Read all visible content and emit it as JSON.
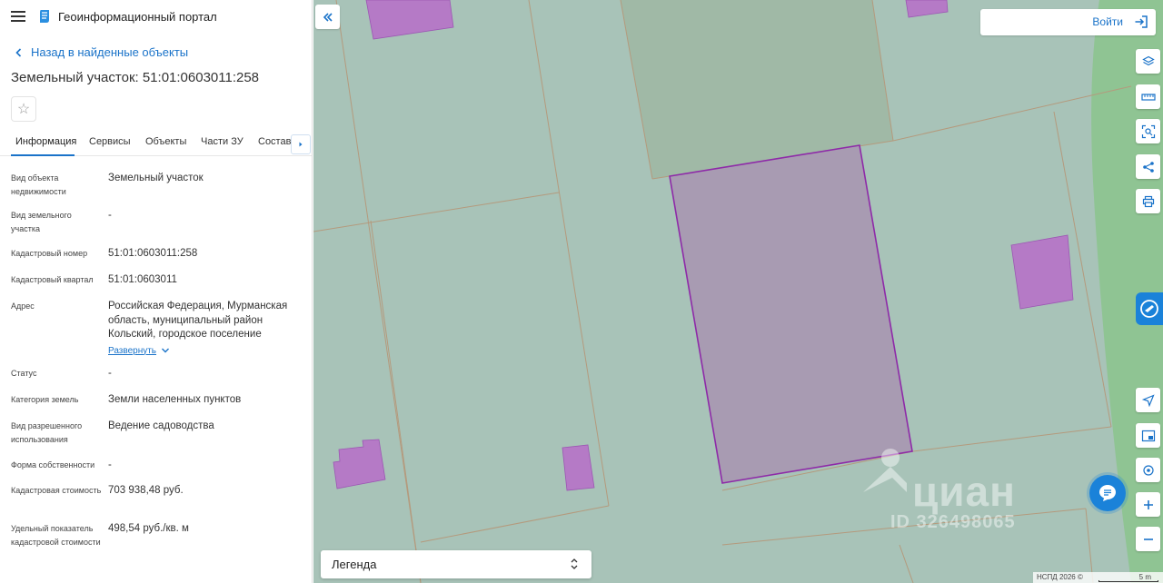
{
  "header": {
    "portal_title": "Геоинформационный портал"
  },
  "nav": {
    "back_label": "Назад в найденные объекты"
  },
  "object": {
    "title": "Земельный участок: 51:01:0603011:258"
  },
  "tabs": [
    {
      "label": "Информация",
      "active": true
    },
    {
      "label": "Сервисы"
    },
    {
      "label": "Объекты"
    },
    {
      "label": "Части ЗУ"
    },
    {
      "label": "Состав"
    }
  ],
  "properties": [
    {
      "label": "Вид объекта недвижимости",
      "value": "Земельный участок"
    },
    {
      "label": "Вид земельного участка",
      "value": "-"
    },
    {
      "label": "Кадастровый номер",
      "value": "51:01:0603011:258"
    },
    {
      "label": "Кадастровый квартал",
      "value": "51:01:0603011"
    },
    {
      "label": "Адрес",
      "value": "Российская Федерация, Мурманская область, муниципальный район Кольский, городское поселение",
      "expand_label": "Развернуть"
    },
    {
      "label": "Статус",
      "value": "-"
    },
    {
      "label": "Категория земель",
      "value": "Земли населенных пунктов"
    },
    {
      "label": "Вид разрешенного использования",
      "value": "Ведение садоводства"
    },
    {
      "label": "Форма собственности",
      "value": "-"
    },
    {
      "label": "Кадастровая стоимость",
      "value": "703 938,48 руб."
    },
    {
      "label": "Удельный показатель кадастровой стоимости",
      "value": "498,54 руб./кв. м"
    }
  ],
  "map": {
    "login_label": "Войти",
    "legend_label": "Легенда",
    "watermark_brand": "циан",
    "watermark_id": "ID 326498065",
    "copyright": "НСПД 2026 ©",
    "scale_label": "5 m",
    "colors": {
      "background": "#a8c3b8",
      "selected_parcel": "#a89bb2",
      "selected_border": "#8e2aa8",
      "building": "#b57ac6",
      "boundary": "#b49a7d",
      "green_zone": "#8fc493",
      "accent": "#1a73c9"
    }
  }
}
